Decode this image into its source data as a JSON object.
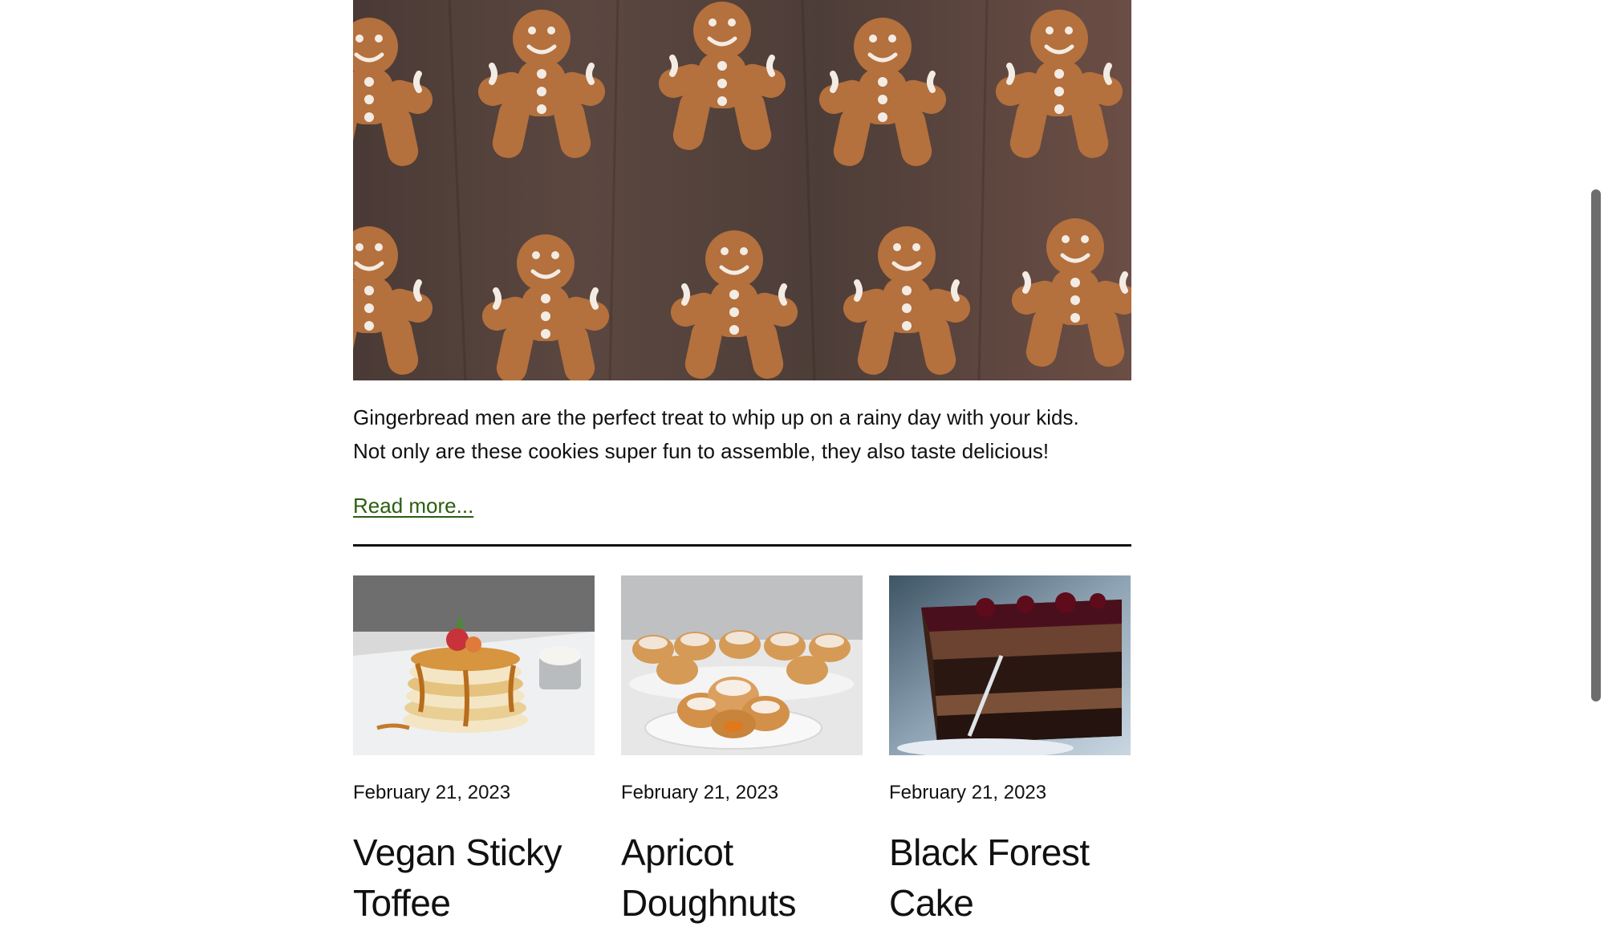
{
  "featured_post": {
    "image_alt": "Gingerbread men cookies on a dark wooden table",
    "excerpt_line1": "Gingerbread men are the perfect treat to whip up on a rainy day with your kids.",
    "excerpt_line2": "Not only are these cookies super fun to assemble, they also taste delicious!",
    "read_more": "Read more..."
  },
  "posts": [
    {
      "date": "February 21, 2023",
      "title_line1": "Vegan Sticky",
      "title_line2": "Toffee",
      "image_subject": "pancake stack with caramel and berries"
    },
    {
      "date": "February 21, 2023",
      "title_line1": "Apricot",
      "title_line2": "Doughnuts",
      "image_subject": "sugar-dusted doughnuts on a plate"
    },
    {
      "date": "February 21, 2023",
      "title_line1": "Black Forest",
      "title_line2": "Cake",
      "image_subject": "slice of chocolate mousse cake with cherry glaze"
    }
  ],
  "colors": {
    "link": "#2c5e12",
    "text": "#111111",
    "scrollbar": "#6d6d6d"
  }
}
